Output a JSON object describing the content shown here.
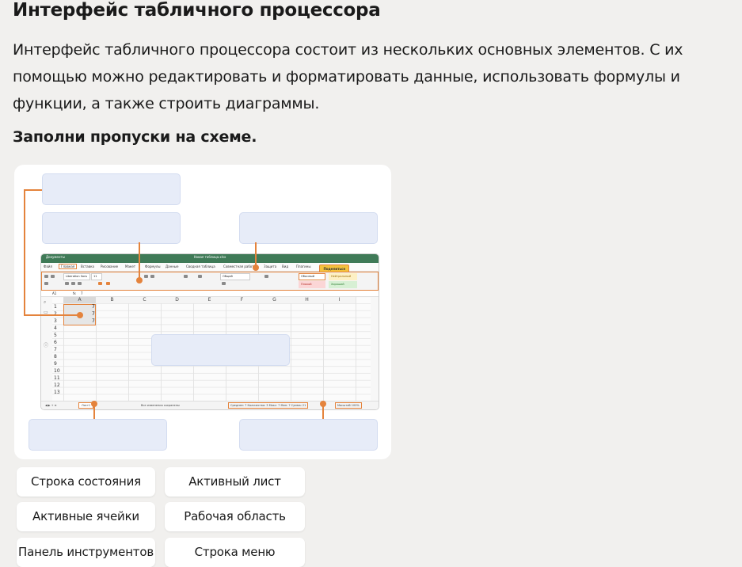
{
  "page": {
    "title": "Интерфейс табличного процессора",
    "intro": "Интерфейс табличного процессора состоит из нескольких основных элементов. С их помощью можно редактировать и форматировать данные, использовать формулы и функции, а также строить диаграммы.",
    "task": "Заполни пропуски на схеме."
  },
  "spreadsheet": {
    "app_label": "Документы",
    "doc_title": "Новая таблица.xlsx",
    "menu": [
      "Файл",
      "Главная",
      "Вставка",
      "Рисование",
      "Макет",
      "Формулы",
      "Данные",
      "Сводная таблица",
      "Совместная работа",
      "Защита",
      "Вид",
      "Плагины"
    ],
    "share_label": "Поделиться",
    "font_name": "Liberation Sans",
    "font_size": "11",
    "number_format": "Общий",
    "styles": {
      "normal": "Обычный",
      "neutral": "Нейтральный",
      "bad": "Плохой",
      "good": "Хороший"
    },
    "cell_ref": "A1",
    "formula_value": "7",
    "columns": [
      "A",
      "B",
      "C",
      "D",
      "E",
      "F",
      "G",
      "H",
      "I"
    ],
    "rows": [
      "1",
      "2",
      "3",
      "4",
      "5",
      "6",
      "7",
      "8",
      "9",
      "10",
      "11",
      "12",
      "13"
    ],
    "cell_values": [
      "7",
      "7",
      "7"
    ],
    "sheet_tab": "Лист1",
    "save_status": "Все изменения сохранены",
    "status_stats": "Среднее: 7   Количество: 3   Макс: 7   Мин: 7   Сумма: 21",
    "zoom": "Масштаб 100%"
  },
  "answer_options": [
    "Строка состояния",
    "Активный лист",
    "Активные ячейки",
    "Рабочая область",
    "Панель инструментов",
    "Строка меню"
  ],
  "colors": {
    "accent": "#e4833c",
    "slot": "#e7ecf8",
    "app_green": "#3f7a57"
  }
}
